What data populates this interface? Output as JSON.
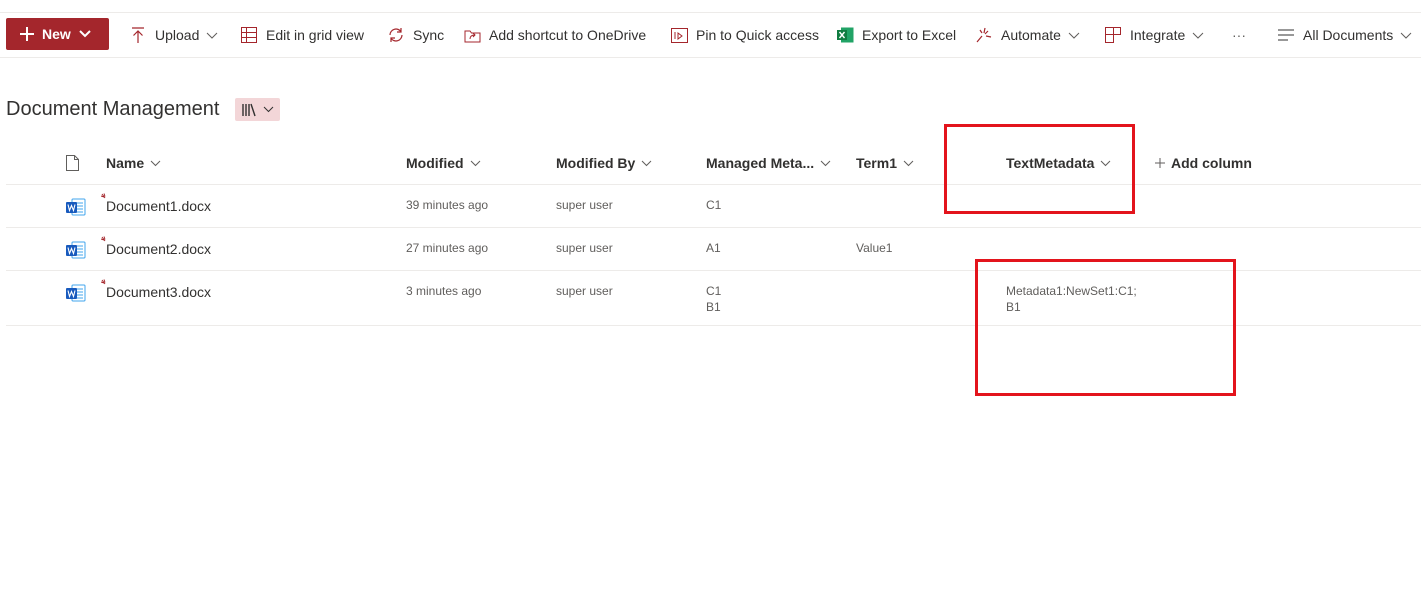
{
  "commandbar": {
    "new_label": "New",
    "upload_label": "Upload",
    "grid_label": "Edit in grid view",
    "sync_label": "Sync",
    "shortcut_label": "Add shortcut to OneDrive",
    "pin_label": "Pin to Quick access",
    "export_label": "Export to Excel",
    "automate_label": "Automate",
    "integrate_label": "Integrate",
    "more_label": "···",
    "view_label": "All Documents"
  },
  "library": {
    "title": "Document Management"
  },
  "columns": {
    "name": "Name",
    "modified": "Modified",
    "modified_by": "Modified By",
    "managed_meta": "Managed Meta...",
    "term1": "Term1",
    "text_metadata": "TextMetadata",
    "add_column": "Add column"
  },
  "rows": [
    {
      "name": "Document1.docx",
      "modified": "39 minutes ago",
      "modified_by": "super user",
      "managed_meta_1": "C1",
      "managed_meta_2": "",
      "term1": "",
      "text_metadata_1": "",
      "text_metadata_2": ""
    },
    {
      "name": "Document2.docx",
      "modified": "27 minutes ago",
      "modified_by": "super user",
      "managed_meta_1": "A1",
      "managed_meta_2": "",
      "term1": "Value1",
      "text_metadata_1": "",
      "text_metadata_2": ""
    },
    {
      "name": "Document3.docx",
      "modified": "3 minutes ago",
      "modified_by": "super user",
      "managed_meta_1": "C1",
      "managed_meta_2": "B1",
      "term1": "",
      "text_metadata_1": "Metadata1:NewSet1:C1;",
      "text_metadata_2": "B1"
    }
  ],
  "colors": {
    "brand": "#a4262c",
    "highlight": "#e3141c",
    "word_blue": "#185abd"
  }
}
